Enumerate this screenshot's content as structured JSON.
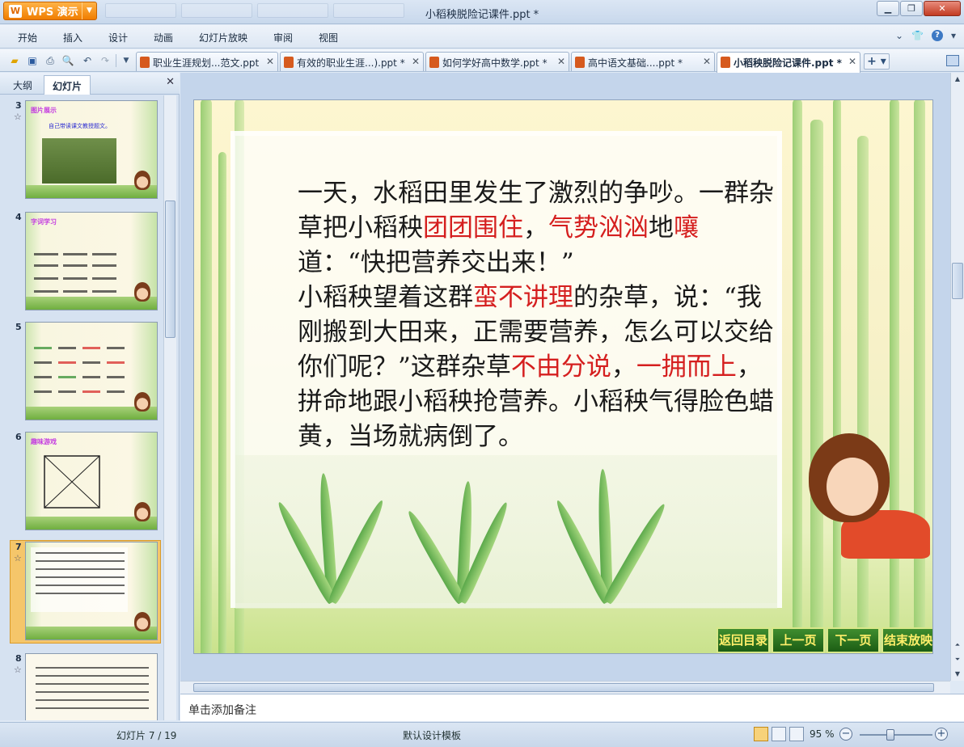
{
  "app": {
    "logo_label": "WPS 演示",
    "window_title": "小稻秧脱险记课件.ppt *"
  },
  "menu": [
    "开始",
    "插入",
    "设计",
    "动画",
    "幻灯片放映",
    "审阅",
    "视图"
  ],
  "doc_tabs": [
    {
      "label": "职业生涯规划...范文.ppt"
    },
    {
      "label": "有效的职业生涯...).ppt *"
    },
    {
      "label": "如何学好高中数学.ppt *"
    },
    {
      "label": "高中语文基础....ppt *"
    },
    {
      "label": "小稻秧脱险记课件.ppt *"
    }
  ],
  "left_panel": {
    "tabs": [
      "大纲",
      "幻灯片"
    ],
    "slide_numbers": [
      "3",
      "4",
      "5",
      "6",
      "7",
      "8"
    ],
    "star_glyph": "☆",
    "selected_slide": "7",
    "thumb3_title": "图片展示",
    "thumb3_caption": "自己带读课文教授题文。",
    "thumb4_title": "字词学习",
    "thumb6_title": "趣味游戏"
  },
  "slide": {
    "paragraph1": [
      {
        "t": "一天，水稻田里发生了激烈的争吵。一群杂草把小稻秧",
        "red": false
      },
      {
        "t": "团团围住",
        "red": true
      },
      {
        "t": "，",
        "red": false
      },
      {
        "t": "气势汹汹",
        "red": true
      },
      {
        "t": "地",
        "red": false
      },
      {
        "t": "嚷",
        "red": true
      },
      {
        "t": "道：“快把营养交出来！”",
        "red": false
      }
    ],
    "paragraph2": [
      {
        "t": "小稻秧望着这群",
        "red": false
      },
      {
        "t": "蛮不讲理",
        "red": true
      },
      {
        "t": "的杂草，说：“我刚搬到大田来，正需要营养，怎么可以交给你们呢？”这群杂草",
        "red": false
      },
      {
        "t": "不由分说",
        "red": true
      },
      {
        "t": "，",
        "red": false
      },
      {
        "t": "一拥而上",
        "red": true
      },
      {
        "t": "，拼命地跟小稻秧抢营养。小稻秧气得脸色蜡黄，当场就病倒了。",
        "red": false
      }
    ],
    "nav_buttons": [
      "返回目录",
      "上一页",
      "下一页",
      "结束放映"
    ]
  },
  "notes_placeholder": "单击添加备注",
  "status": {
    "slide_info": "幻灯片 7 / 19",
    "template": "默认设计模板",
    "zoom": "95 %",
    "zoom_minus": "−",
    "zoom_plus": "+"
  },
  "colors": {
    "accent_red": "#d51f1f",
    "wps_orange": "#f07d00",
    "nav_green": "#1c5d14"
  }
}
